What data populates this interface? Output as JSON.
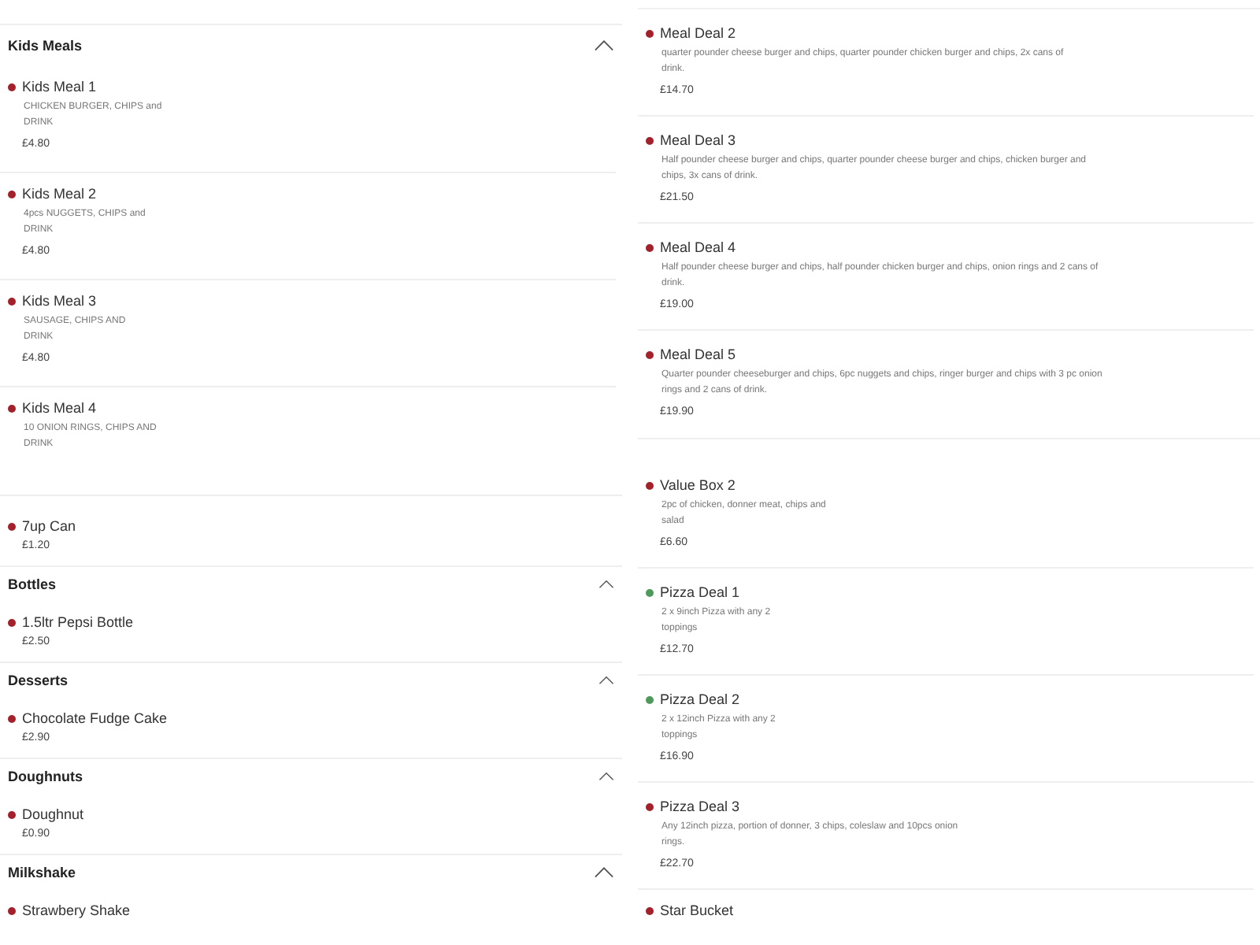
{
  "left_sections": [
    {
      "title": "Kids Meals",
      "items": [
        {
          "name": "Kids Meal 1",
          "description": [
            "CHICKEN BURGER, CHIPS and",
            "DRINK"
          ],
          "price": "£4.80",
          "color": "#a3212b"
        },
        {
          "name": "Kids Meal 2",
          "description": [
            "4pcs NUGGETS, CHIPS and",
            "DRINK"
          ],
          "price": "£4.80",
          "color": "#a3212b"
        },
        {
          "name": "Kids Meal 3",
          "description": [
            "SAUSAGE, CHIPS AND",
            "DRINK"
          ],
          "price": "£4.80",
          "color": "#a3212b"
        },
        {
          "name": "Kids Meal 4",
          "description": [
            "10 ONION RINGS, CHIPS AND",
            "DRINK"
          ],
          "color": "#a3212b"
        }
      ]
    },
    {
      "items": [
        {
          "name": "7up Can",
          "price": "£1.20",
          "color": "#a3212b"
        }
      ]
    },
    {
      "title": "Bottles",
      "items": [
        {
          "name": "1.5ltr Pepsi Bottle",
          "price": "£2.50",
          "color": "#a3212b"
        }
      ]
    },
    {
      "title": "Desserts",
      "items": [
        {
          "name": "Chocolate Fudge Cake",
          "price": "£2.90",
          "color": "#a3212b"
        }
      ]
    },
    {
      "title": "Doughnuts",
      "items": [
        {
          "name": "Doughnut",
          "price": "£0.90",
          "color": "#a3212b"
        }
      ]
    },
    {
      "title": "Milkshake",
      "items": [
        {
          "name": "Strawbery Shake",
          "color": "#a3212b"
        }
      ]
    }
  ],
  "right_sections": [
    {
      "items": [
        {
          "name": "Meal Deal 2",
          "description": [
            "quarter pounder cheese burger and chips, quarter pounder chicken burger and chips, 2x cans of",
            "drink."
          ],
          "price": "£14.70",
          "color": "#a3212b"
        },
        {
          "name": "Meal Deal 3",
          "description": [
            "Half pounder cheese burger and chips, quarter pounder cheese burger and chips, chicken burger and",
            "chips, 3x cans of drink."
          ],
          "price": "£21.50",
          "color": "#a3212b"
        },
        {
          "name": "Meal Deal 4",
          "description": [
            "Half pounder cheese burger and chips, half pounder chicken burger and chips, onion rings and 2 cans of",
            "drink."
          ],
          "price": "£19.00",
          "color": "#a3212b"
        },
        {
          "name": "Meal Deal 5",
          "description": [
            "Quarter pounder cheeseburger and chips, 6pc nuggets and chips, ringer burger and chips with 3 pc onion",
            "rings and 2 cans of drink."
          ],
          "price": "£19.90",
          "color": "#a3212b"
        }
      ]
    },
    {
      "items": [
        {
          "name": "Value Box 2",
          "description": [
            "2pc of chicken, donner meat, chips and",
            "salad"
          ],
          "price": "£6.60",
          "color": "#a3212b"
        },
        {
          "name": "Pizza Deal 1",
          "description": [
            "2 x 9inch Pizza with any 2",
            "toppings"
          ],
          "price": "£12.70",
          "color": "#4e9a5a"
        },
        {
          "name": "Pizza Deal 2",
          "description": [
            "2 x 12inch Pizza with any 2",
            "toppings"
          ],
          "price": "£16.90",
          "color": "#4e9a5a"
        },
        {
          "name": "Pizza Deal 3",
          "description": [
            "Any 12inch pizza, portion of donner, 3 chips, coleslaw and 10pcs onion",
            "rings."
          ],
          "price": "£22.70",
          "color": "#a3212b"
        },
        {
          "name": "Star Bucket",
          "color": "#a3212b"
        }
      ]
    }
  ]
}
